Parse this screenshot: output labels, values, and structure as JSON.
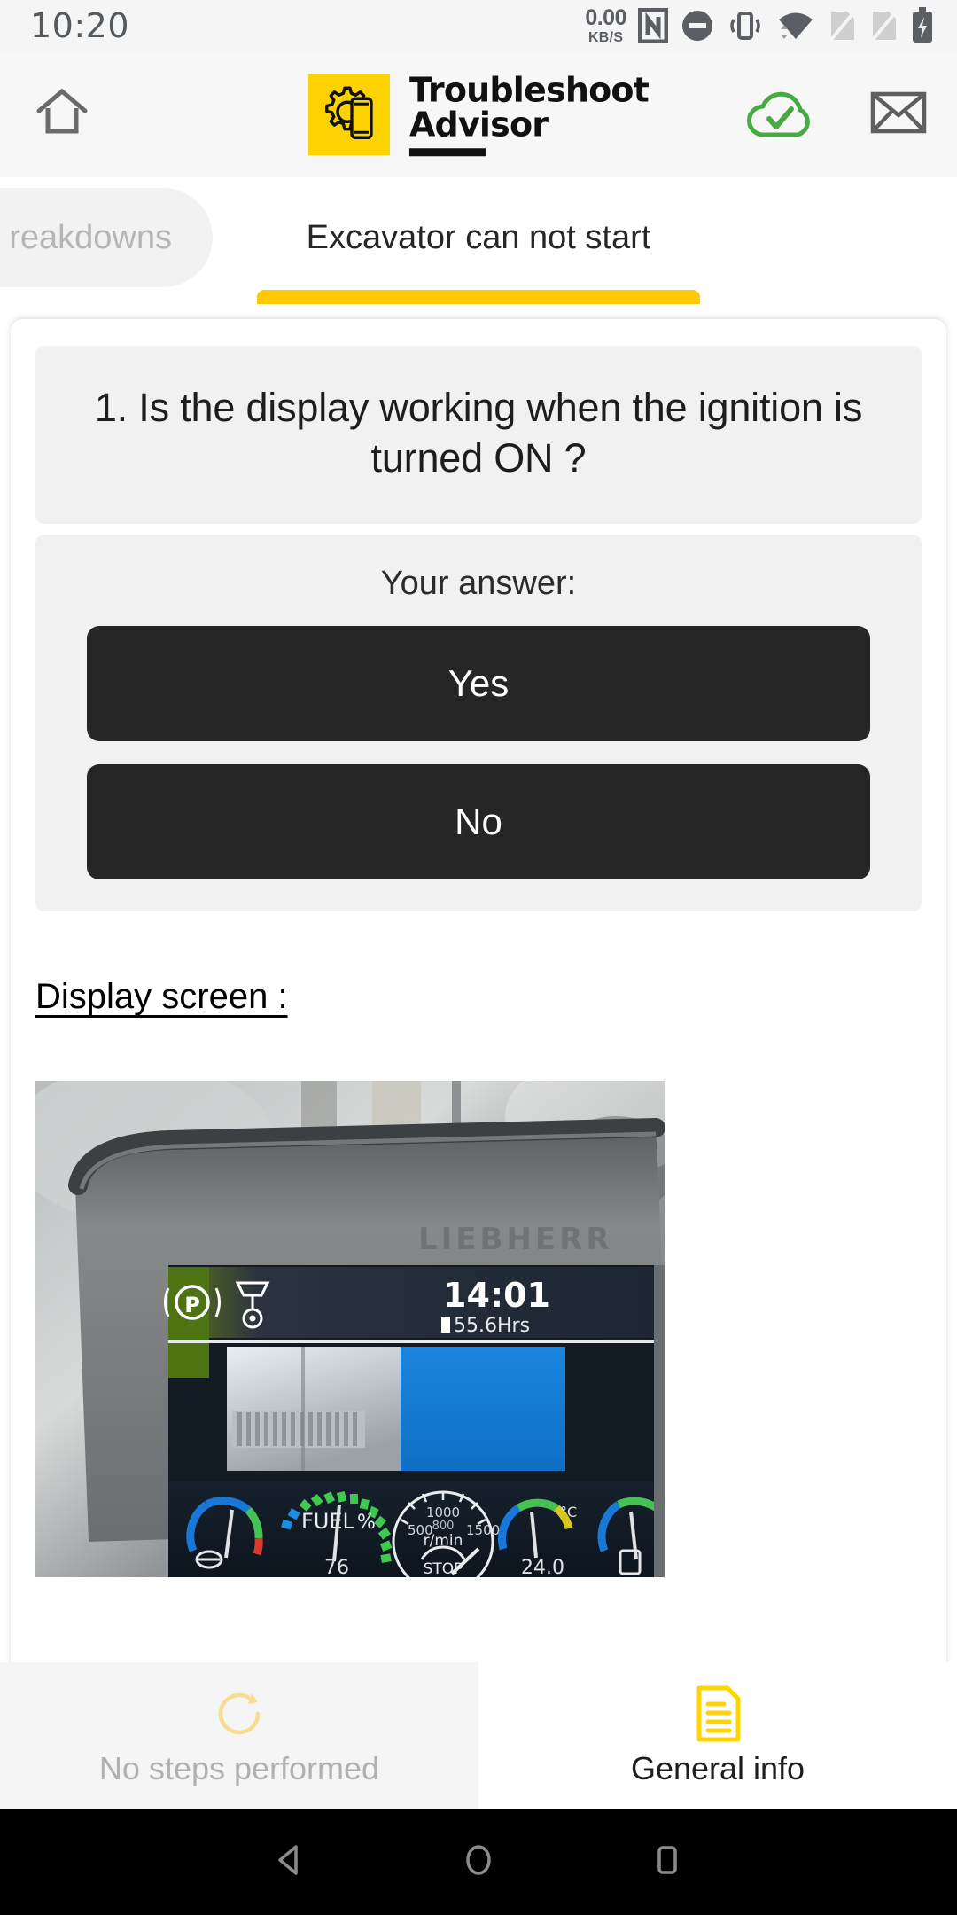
{
  "status_bar": {
    "time": "10:20",
    "net_speed_value": "0.00",
    "net_speed_unit": "KB/S",
    "icons": [
      "nfc-icon",
      "do-not-disturb-icon",
      "vibrate-icon",
      "wifi-icon",
      "sim1-off-icon",
      "sim2-off-icon",
      "battery-charging-icon"
    ]
  },
  "header": {
    "home_icon": "home-icon",
    "brand_line1": "Troubleshoot",
    "brand_line2": "Advisor",
    "logo_icon": "gear-phone-icon",
    "logo_bg": "#FCD200",
    "sync_icon": "cloud-check-icon",
    "sync_color": "#49a942",
    "mail_icon": "envelope-icon"
  },
  "tabs": {
    "inactive_label": "reakdowns",
    "active_label": "Excavator can not start",
    "indicator_color": "#FFC907"
  },
  "question": {
    "text": "1. Is the display working when the ignition is turned ON ?"
  },
  "answer": {
    "label": "Your answer:",
    "options": [
      {
        "label": "Yes"
      },
      {
        "label": "No"
      }
    ]
  },
  "media": {
    "section_title": "Display screen :",
    "photo_alt": "liebherr-display-photo",
    "photo_brand": "LIEBHERR",
    "photo_time": "14:01",
    "photo_hours": "55.6Hrs",
    "photo_fuel_label": "FUEL",
    "photo_fuel_pct": "%",
    "photo_fuel_value": "76",
    "photo_rpm_unit": "r/min",
    "photo_rpm_ticks": [
      "500",
      "1000",
      "1500"
    ],
    "photo_stop_label": "STOP",
    "photo_temp_value": "24.0",
    "photo_temp_unit": "°C"
  },
  "bottom_bar": {
    "left_label": "No steps performed",
    "left_icon": "refresh-circle-icon",
    "right_label": "General info",
    "right_icon": "document-icon",
    "accent": "#FFD400"
  },
  "android_nav": {
    "back_icon": "triangle-back-icon",
    "home_icon": "circle-home-icon",
    "recents_icon": "square-recents-icon"
  }
}
